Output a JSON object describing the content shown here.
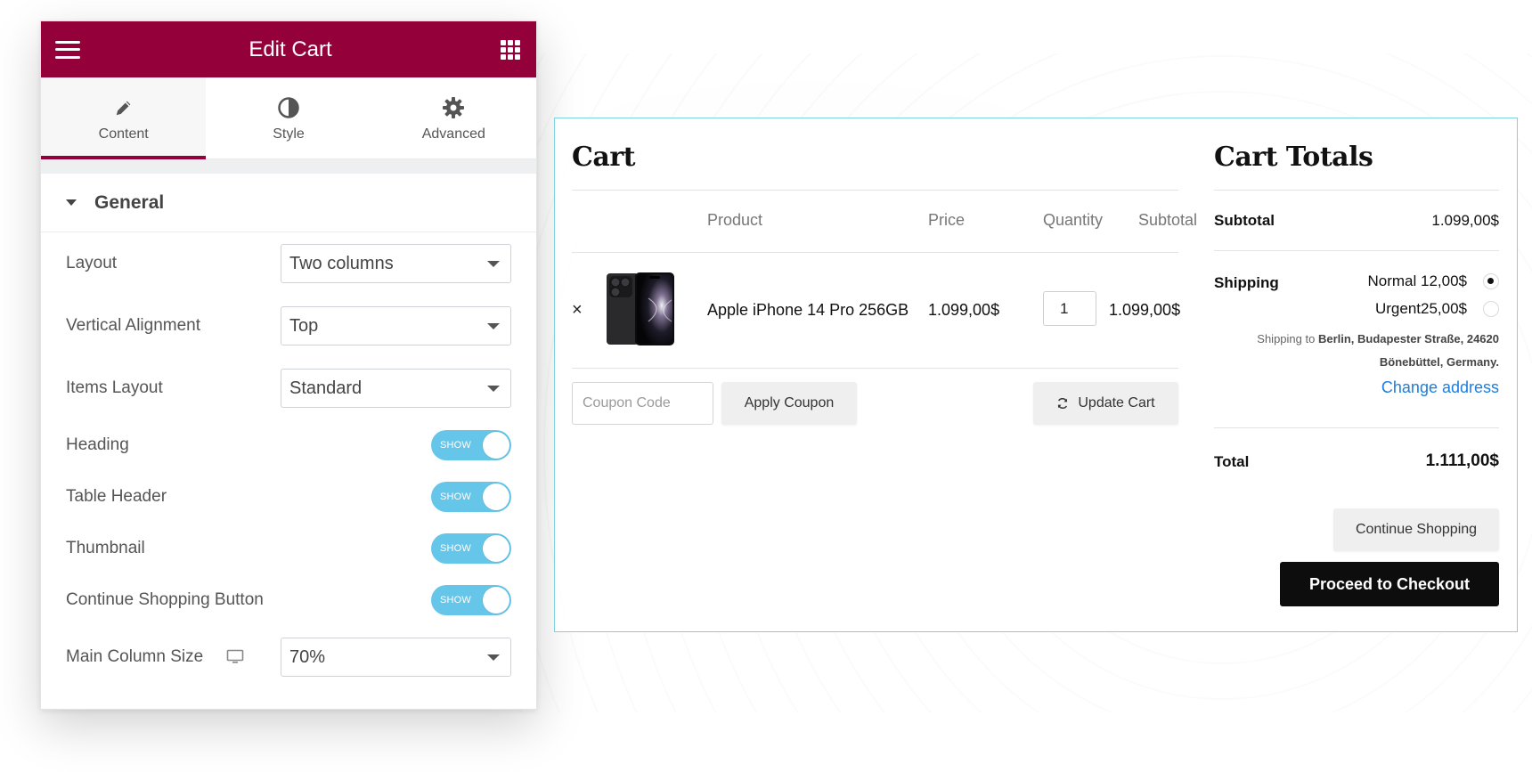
{
  "panel": {
    "title": "Edit Cart",
    "tabs": [
      {
        "label": "Content",
        "icon": "pencil-icon"
      },
      {
        "label": "Style",
        "icon": "half-circle-icon"
      },
      {
        "label": "Advanced",
        "icon": "gear-icon"
      }
    ],
    "section": {
      "title": "General"
    },
    "controls": {
      "layout": {
        "label": "Layout",
        "value": "Two columns"
      },
      "vertical_alignment": {
        "label": "Vertical Alignment",
        "value": "Top"
      },
      "items_layout": {
        "label": "Items Layout",
        "value": "Standard"
      },
      "heading": {
        "label": "Heading",
        "toggle": "SHOW"
      },
      "table_header": {
        "label": "Table Header",
        "toggle": "SHOW"
      },
      "thumbnail": {
        "label": "Thumbnail",
        "toggle": "SHOW"
      },
      "continue_shopping": {
        "label": "Continue Shopping Button",
        "toggle": "SHOW"
      },
      "main_column_size": {
        "label": "Main Column Size",
        "value": "70%"
      }
    },
    "colors": {
      "header": "#93003a",
      "toggle": "#66c6ea"
    }
  },
  "cart": {
    "heading": "Cart",
    "columns": {
      "product": "Product",
      "price": "Price",
      "quantity": "Quantity",
      "subtotal": "Subtotal"
    },
    "items": [
      {
        "remove": "×",
        "name": "Apple iPhone 14 Pro 256GB",
        "price": "1.099,00$",
        "quantity": "1",
        "subtotal": "1.099,00$"
      }
    ],
    "coupon_placeholder": "Coupon Code",
    "apply_coupon": "Apply Coupon",
    "update_cart": "Update Cart"
  },
  "totals": {
    "heading": "Cart Totals",
    "subtotal_label": "Subtotal",
    "subtotal_value": "1.099,00$",
    "shipping_label": "Shipping",
    "shipping_options": [
      {
        "label": "Normal 12,00$",
        "checked": true
      },
      {
        "label": "Urgent25,00$",
        "checked": false
      }
    ],
    "shipping_to_prefix": "Shipping to",
    "shipping_to_line1": "Berlin, Budapester Straße, 24620",
    "shipping_to_line2": "Bönebüttel, Germany.",
    "change_address": "Change address",
    "total_label": "Total",
    "total_value": "1.111,00$",
    "continue_shopping": "Continue Shopping",
    "checkout": "Proceed to Checkout"
  },
  "widget_border_color": "#7fd3e0"
}
